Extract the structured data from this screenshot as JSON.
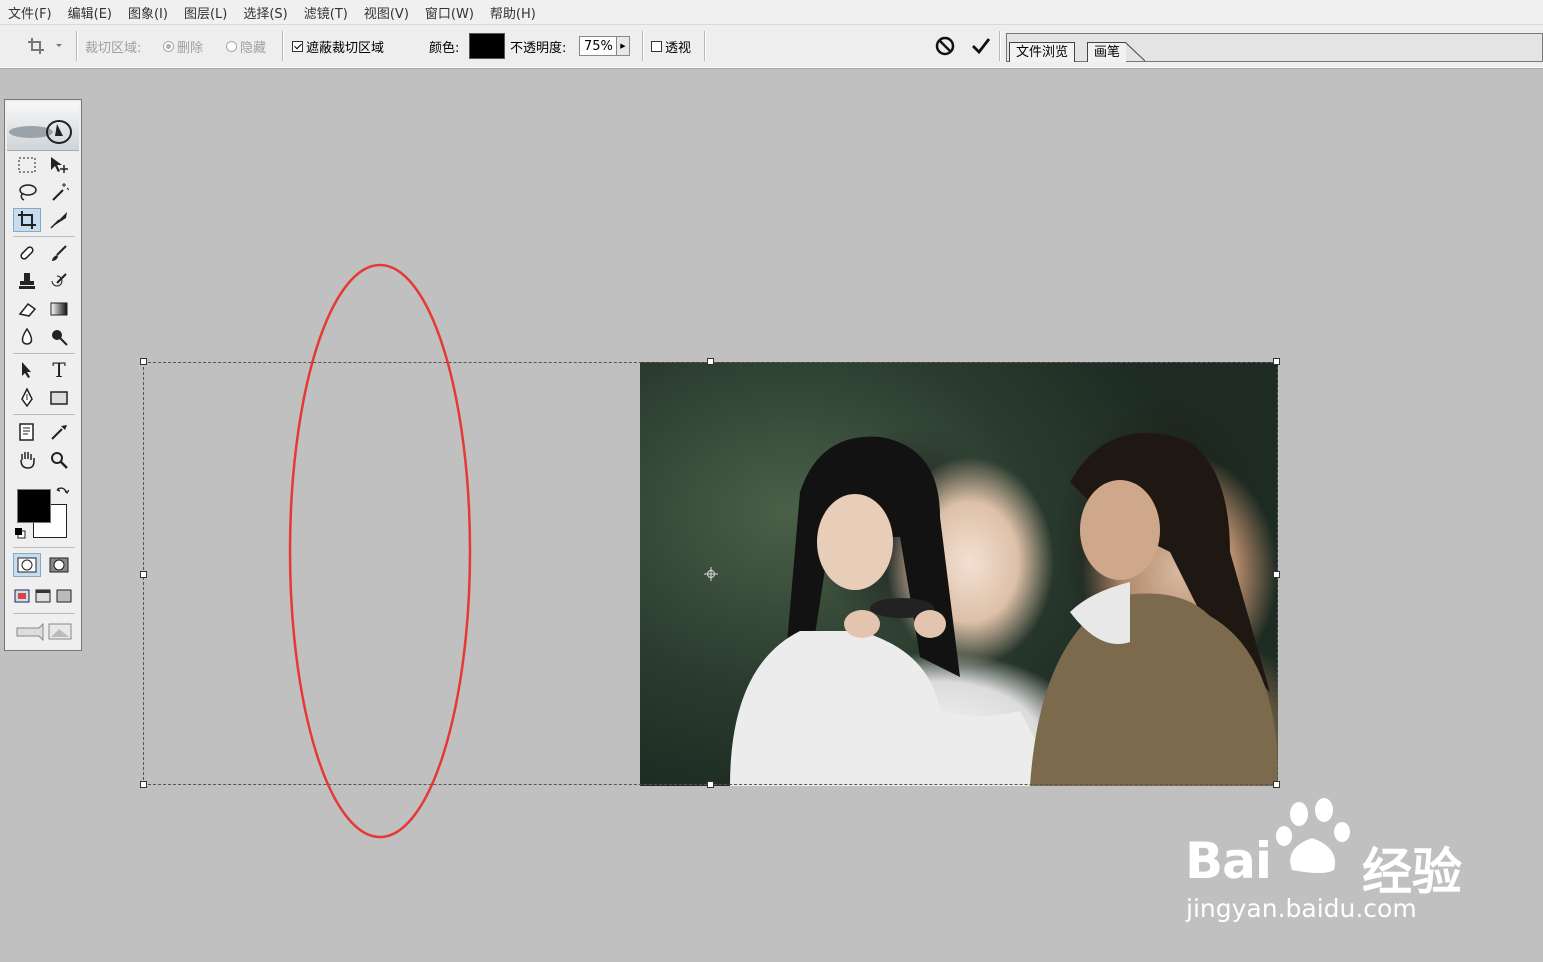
{
  "menu": [
    "文件(F)",
    "编辑(E)",
    "图象(I)",
    "图层(L)",
    "选择(S)",
    "滤镜(T)",
    "视图(V)",
    "窗口(W)",
    "帮助(H)"
  ],
  "options": {
    "tool_icon": "crop-icon",
    "crop_area_label": "裁切区域:",
    "delete_label": "删除",
    "hide_label": "隐藏",
    "shield_label": "遮蔽裁切区域",
    "shield_checked": true,
    "color_label": "颜色:",
    "shield_color": "#000000",
    "opacity_label": "不透明度:",
    "opacity_value": "75%",
    "perspective_label": "透视",
    "perspective_checked": false
  },
  "palette_well": {
    "tabs": [
      "文件浏览",
      "画笔"
    ]
  },
  "toolbox": {
    "tools": [
      "marquee-icon",
      "move-icon",
      "lasso-icon",
      "magic-wand-icon",
      "crop-icon",
      "slice-icon",
      "healing-brush-icon",
      "brush-icon",
      "clone-stamp-icon",
      "history-brush-icon",
      "eraser-icon",
      "gradient-icon",
      "blur-icon",
      "dodge-icon",
      "path-selection-icon",
      "type-icon",
      "pen-icon",
      "shape-icon",
      "notes-icon",
      "eyedropper-icon",
      "hand-icon",
      "zoom-icon"
    ],
    "type_tool_glyph": "T",
    "foreground_color": "#000000",
    "background_color": "#ffffff"
  },
  "watermark": {
    "brand": "Bai",
    "brand2": "经验",
    "url": "jingyan.baidu.com"
  }
}
